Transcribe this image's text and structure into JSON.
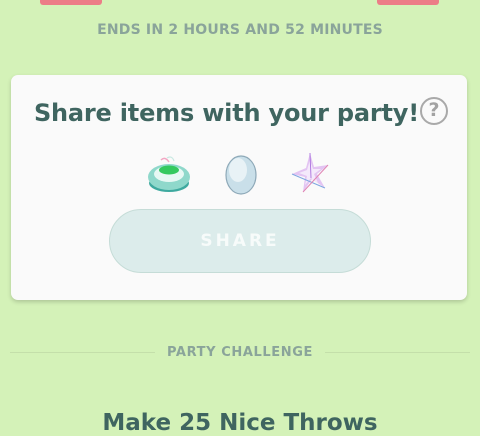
{
  "event": {
    "ends_text": "ENDS IN 2 HOURS AND 52 MINUTES"
  },
  "share_card": {
    "title": "Share items with your party!",
    "help_symbol": "?",
    "items": [
      {
        "icon": "incense-icon"
      },
      {
        "icon": "egg-icon"
      },
      {
        "icon": "stardust-icon"
      }
    ],
    "share_label": "SHARE"
  },
  "party_challenge": {
    "section_label": "PARTY CHALLENGE",
    "challenge_title": "Make 25 Nice Throws"
  },
  "colors": {
    "background": "#d4f2b8",
    "ribbon": "#ec7d87",
    "title_text": "#3f6560",
    "muted_text": "#8aa49a",
    "share_button": "#dceceb"
  }
}
